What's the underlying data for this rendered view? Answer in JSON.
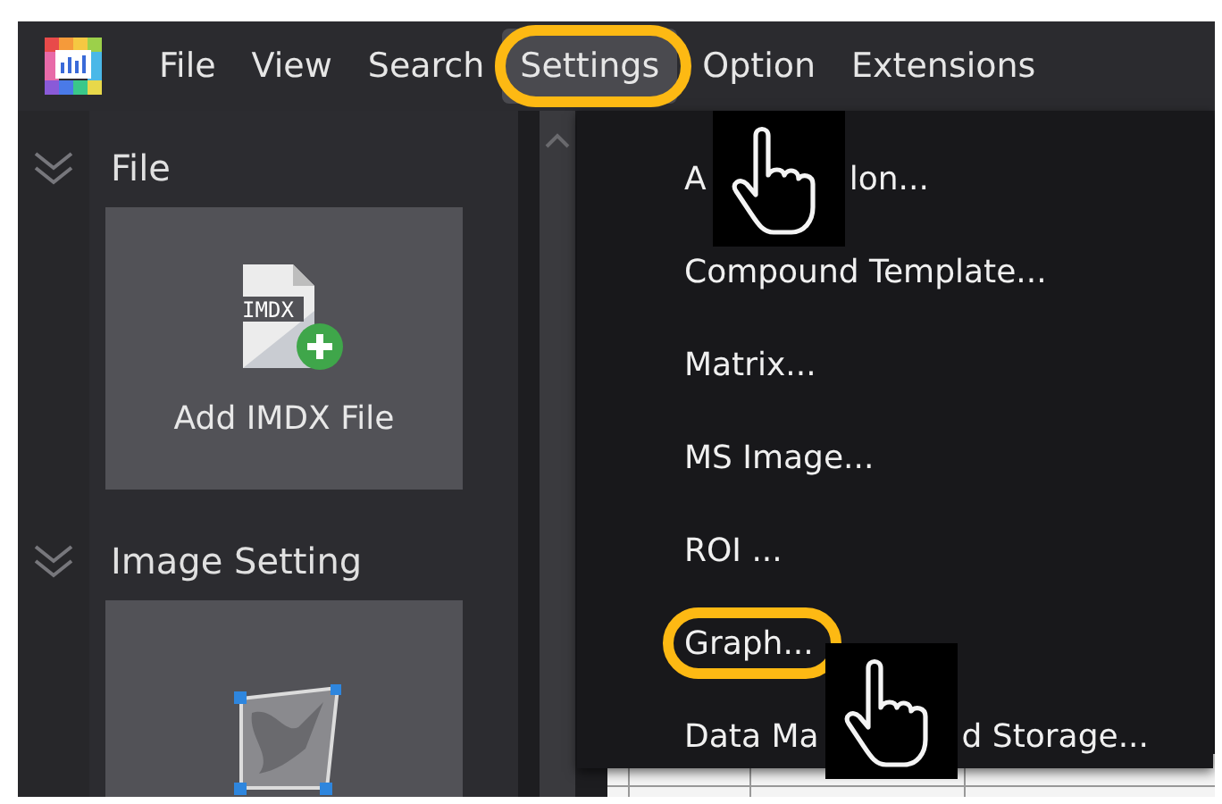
{
  "menubar": {
    "items": [
      {
        "label": "File",
        "selected": false,
        "highlighted": false
      },
      {
        "label": "View",
        "selected": false,
        "highlighted": false
      },
      {
        "label": "Search",
        "selected": false,
        "highlighted": false
      },
      {
        "label": "Settings",
        "selected": true,
        "highlighted": true
      },
      {
        "label": "Option",
        "selected": false,
        "highlighted": false
      },
      {
        "label": "Extensions",
        "selected": false,
        "highlighted": false
      }
    ]
  },
  "sidebar": {
    "sections": [
      {
        "title": "File",
        "tile": {
          "label": "Add IMDX File",
          "icon_text": "IMDX",
          "kind": "file"
        }
      },
      {
        "title": "Image Setting",
        "tile": {
          "kind": "image"
        }
      }
    ]
  },
  "dropdown": {
    "items": [
      {
        "fragments": [
          "A",
          "lon..."
        ],
        "highlighted": false
      },
      {
        "fragments": [
          "Compound Template..."
        ],
        "highlighted": false
      },
      {
        "fragments": [
          "Matrix..."
        ],
        "highlighted": false
      },
      {
        "fragments": [
          "MS Image..."
        ],
        "highlighted": false
      },
      {
        "fragments": [
          "ROI ..."
        ],
        "highlighted": false
      },
      {
        "fragments": [
          "Graph..."
        ],
        "highlighted": true
      },
      {
        "fragments": [
          "Data Ma",
          "d Storage..."
        ],
        "highlighted": false
      }
    ]
  }
}
